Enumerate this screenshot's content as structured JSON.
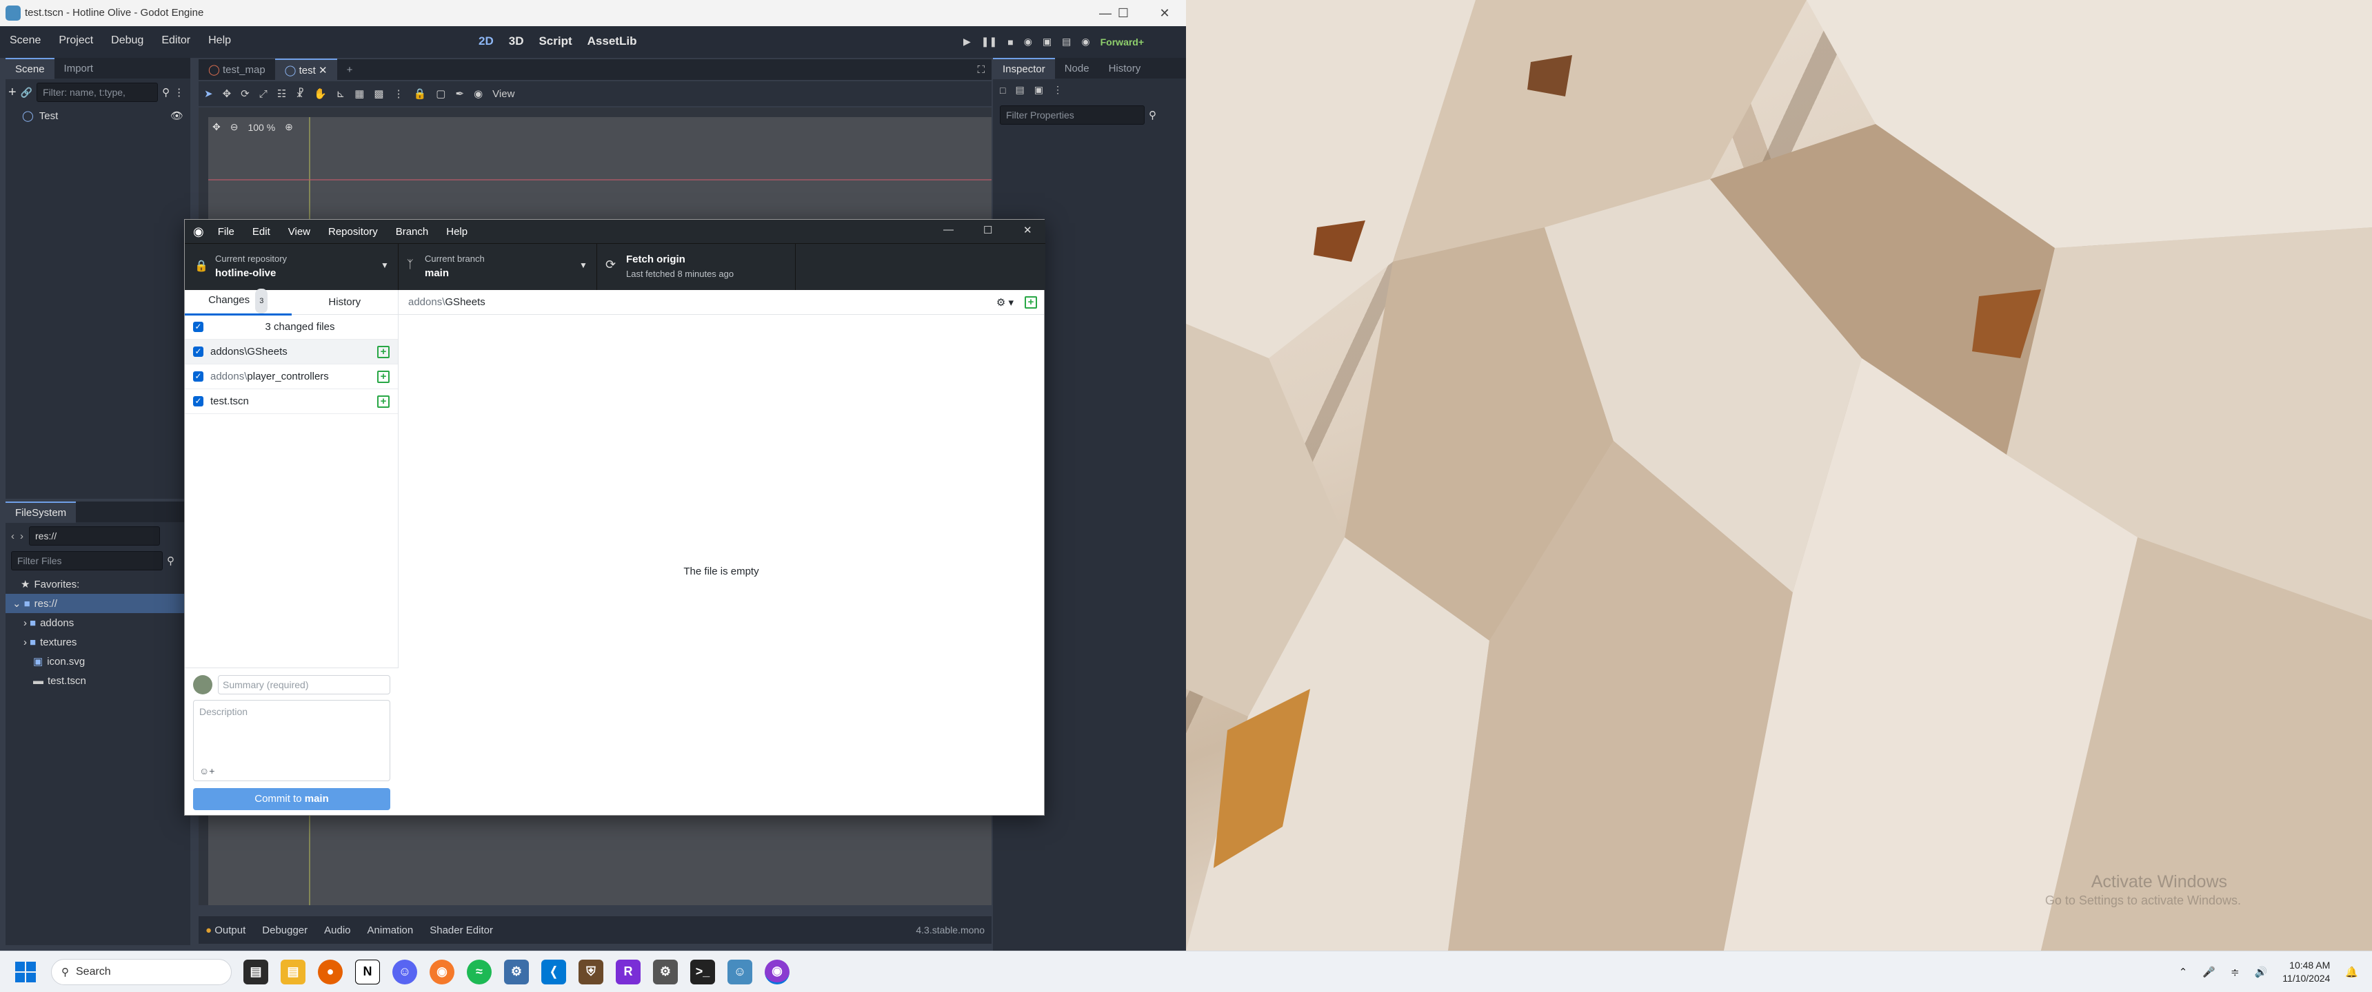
{
  "godot": {
    "window_title": "test.tscn - Hotline Olive - Godot Engine",
    "menu": [
      "Scene",
      "Project",
      "Debug",
      "Editor",
      "Help"
    ],
    "workspaces": [
      "2D",
      "3D",
      "Script",
      "AssetLib"
    ],
    "renderer": "Forward+",
    "scene_dock": {
      "tabs": [
        "Scene",
        "Import"
      ],
      "filter_placeholder": "Filter: name, t:type,",
      "root_node": "Test"
    },
    "editor_tabs": [
      "test_map",
      "test"
    ],
    "viewport_toolbar": {
      "view_label": "View",
      "zoom": "100 %"
    },
    "filesystem": {
      "title": "FileSystem",
      "path": "res://",
      "filter_placeholder": "Filter Files",
      "favorites": "Favorites:",
      "items": [
        "res://",
        "addons",
        "textures",
        "icon.svg",
        "test.tscn"
      ]
    },
    "inspector": {
      "tabs": [
        "Inspector",
        "Node",
        "History"
      ],
      "filter_placeholder": "Filter Properties"
    },
    "bottom_tabs": [
      "Output",
      "Debugger",
      "Audio",
      "Animation",
      "Shader Editor"
    ],
    "version": "4.3.stable.mono"
  },
  "github_desktop": {
    "menu": [
      "File",
      "Edit",
      "View",
      "Repository",
      "Branch",
      "Help"
    ],
    "repo_label": "Current repository",
    "repo_name": "hotline-olive",
    "branch_label": "Current branch",
    "branch_name": "main",
    "fetch_label": "Fetch origin",
    "fetch_sub": "Last fetched 8 minutes ago",
    "tabs": {
      "changes": "Changes",
      "changes_count": "3",
      "history": "History"
    },
    "changed_files_label": "3 changed files",
    "files": [
      {
        "dir": "",
        "name": "addons\\GSheets"
      },
      {
        "dir": "addons\\",
        "name": "player_controllers"
      },
      {
        "dir": "",
        "name": "test.tscn"
      }
    ],
    "summary_placeholder": "Summary (required)",
    "description_placeholder": "Description",
    "commit_prefix": "Commit to ",
    "commit_branch": "main",
    "diff_path": {
      "dir": "addons\\",
      "name": "GSheets"
    },
    "empty_message": "The file is empty"
  },
  "desktop": {
    "watermark_title": "Activate Windows",
    "watermark_sub": "Go to Settings to activate Windows."
  },
  "taskbar": {
    "search_label": "Search",
    "time": "10:48 AM",
    "date": "11/10/2024",
    "apps": [
      "file-explorer-icon",
      "firefox-icon",
      "notion-icon",
      "discord-icon",
      "blender-icon",
      "spotify-icon",
      "settings-app-icon",
      "vscode-icon",
      "shield-app-icon",
      "rider-icon",
      "gear-app-icon",
      "terminal-icon",
      "godot-icon",
      "github-desktop-icon"
    ]
  }
}
